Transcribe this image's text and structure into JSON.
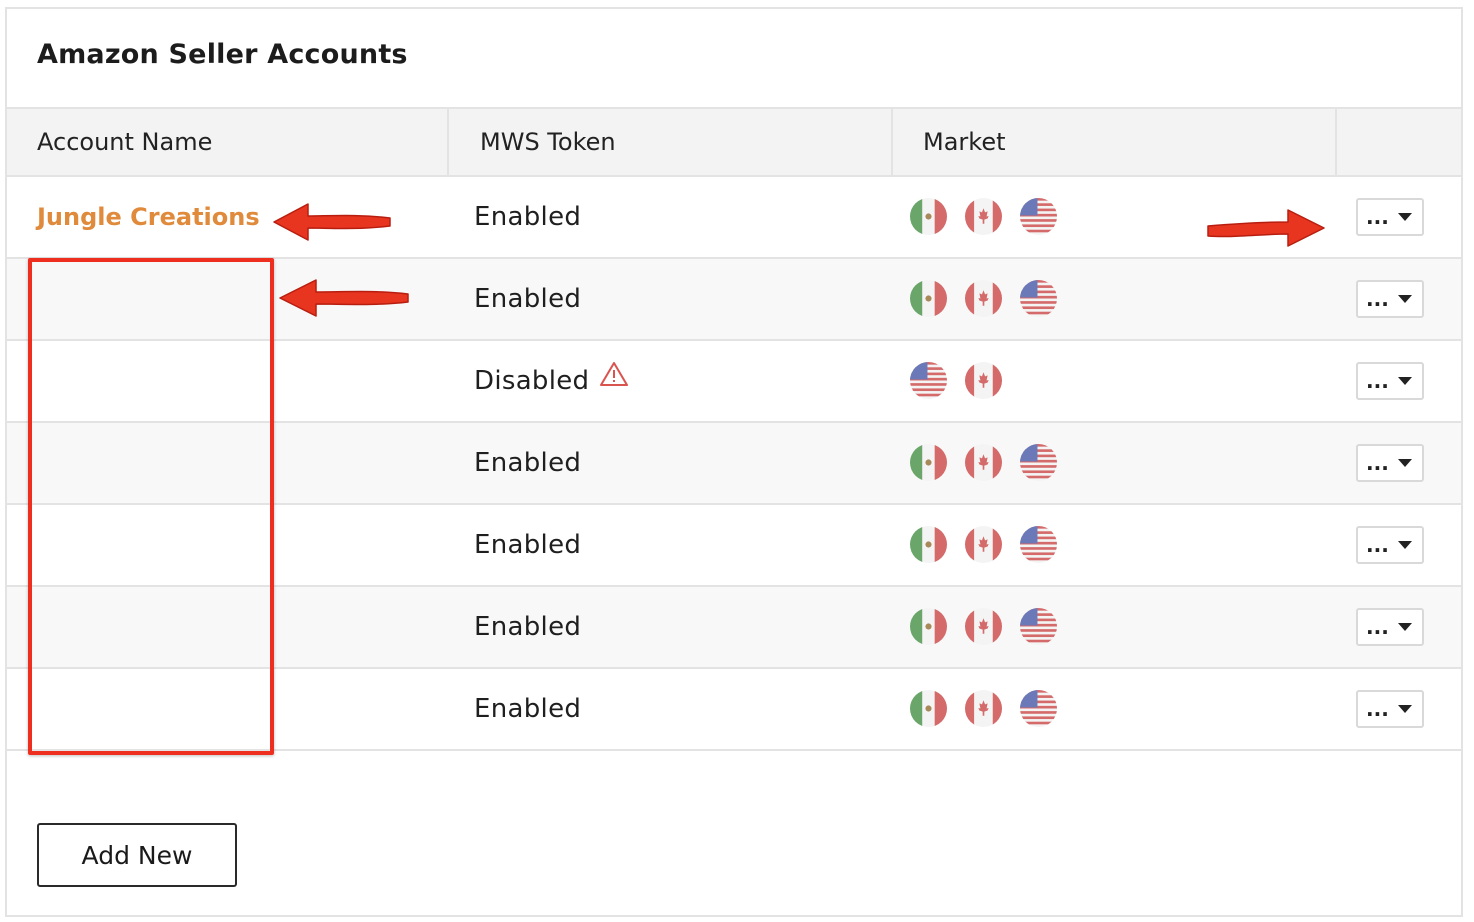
{
  "panel": {
    "title": "Amazon Seller Accounts"
  },
  "table": {
    "columns": [
      "Account Name",
      "MWS Token",
      "Market"
    ],
    "actions_label": "...",
    "rows": [
      {
        "account_name": "Jungle Creations",
        "token_status": "Enabled",
        "warning": false,
        "markets": [
          "mx-flag-icon",
          "ca-flag-icon",
          "us-flag-icon"
        ]
      },
      {
        "account_name": "",
        "token_status": "Enabled",
        "warning": false,
        "markets": [
          "mx-flag-icon",
          "ca-flag-icon",
          "us-flag-icon"
        ]
      },
      {
        "account_name": "",
        "token_status": "Disabled",
        "warning": true,
        "markets": [
          "us-flag-icon",
          "ca-flag-icon"
        ]
      },
      {
        "account_name": "",
        "token_status": "Enabled",
        "warning": false,
        "markets": [
          "mx-flag-icon",
          "ca-flag-icon",
          "us-flag-icon"
        ]
      },
      {
        "account_name": "",
        "token_status": "Enabled",
        "warning": false,
        "markets": [
          "mx-flag-icon",
          "ca-flag-icon",
          "us-flag-icon"
        ]
      },
      {
        "account_name": "",
        "token_status": "Enabled",
        "warning": false,
        "markets": [
          "mx-flag-icon",
          "ca-flag-icon",
          "us-flag-icon"
        ]
      },
      {
        "account_name": "",
        "token_status": "Enabled",
        "warning": false,
        "markets": [
          "mx-flag-icon",
          "ca-flag-icon",
          "us-flag-icon"
        ]
      }
    ]
  },
  "footer": {
    "add_label": "Add New"
  },
  "colors": {
    "accent_link": "#e08a3c",
    "annotation_red": "#ee2e1e",
    "warning": "#d9534f"
  }
}
